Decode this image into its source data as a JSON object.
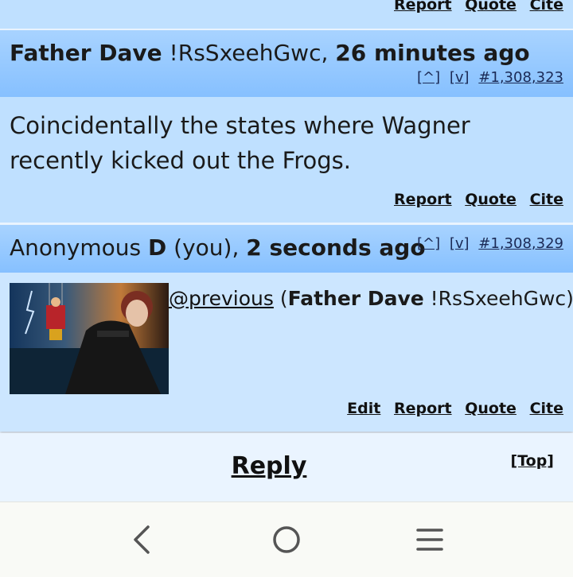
{
  "previous_post": {
    "actions": {
      "report": "Report",
      "quote": "Quote",
      "cite": "Cite"
    }
  },
  "post1": {
    "author": "Father Dave",
    "tripcode": "!RsSxeehGwc,",
    "time": "26 minutes ago",
    "nav_up": "[^]",
    "nav_down": "[v]",
    "post_number": "#1,308,323",
    "message": "Coincidentally the states where Wagner recently kicked out the Frogs.",
    "actions": {
      "report": "Report",
      "quote": "Quote",
      "cite": "Cite"
    }
  },
  "post2": {
    "author_prefix": "Anonymous",
    "author_id": "D",
    "you_tag": "(you),",
    "time": "2 seconds ago",
    "nav_up": "[^]",
    "nav_down": "[v]",
    "post_number": "#1,308,329",
    "quote_link": "@previous",
    "quote_paren_open": "(",
    "quote_author": "Father Dave",
    "quote_trip": "!RsSxeehGwc)",
    "actions": {
      "edit": "Edit",
      "report": "Report",
      "quote": "Quote",
      "cite": "Cite"
    }
  },
  "footer": {
    "reply": "Reply",
    "top": "[Top]"
  },
  "colors": {
    "header_blue": "#86c0ff",
    "body_blue": "#bfe0ff",
    "page_bg": "#eaf4ff",
    "nav_bg": "#f9faf6"
  },
  "nav_icons": [
    "back-icon",
    "home-icon",
    "recents-icon"
  ]
}
